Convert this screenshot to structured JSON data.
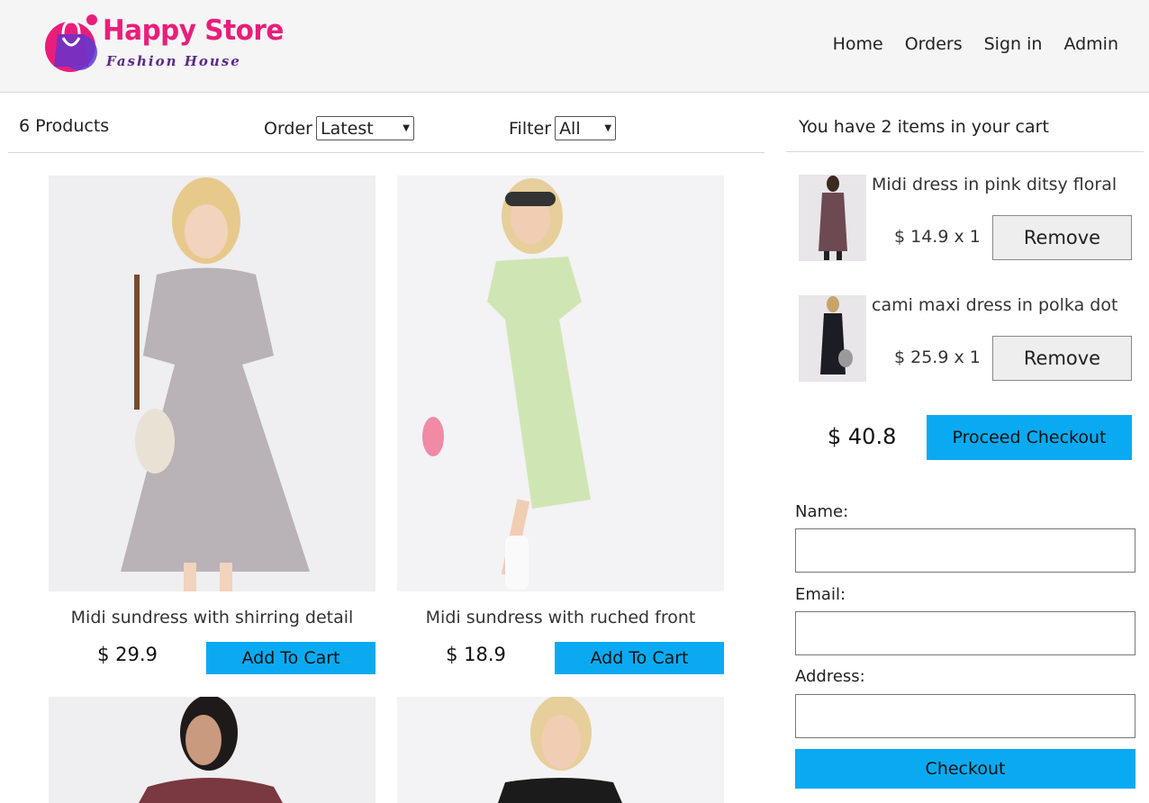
{
  "header": {
    "logo_title": "Happy Store",
    "logo_subtitle": "Fashion House",
    "nav": [
      "Home",
      "Orders",
      "Sign in",
      "Admin"
    ]
  },
  "toolbar": {
    "count": "6 Products",
    "order_label": "Order",
    "order_value": "Latest",
    "filter_label": "Filter",
    "filter_value": "All"
  },
  "products": [
    {
      "title": "Midi sundress with shirring detail",
      "price": "$ 29.9",
      "button": "Add To Cart",
      "color": "#b9b2b6"
    },
    {
      "title": "Midi sundress with ruched front",
      "price": "$ 18.9",
      "button": "Add To Cart",
      "color": "#cfe6b4"
    },
    {
      "title": "",
      "price": "",
      "button": "",
      "color": "#7a3840"
    },
    {
      "title": "",
      "price": "",
      "button": "",
      "color": "#1b1b1b"
    }
  ],
  "cart": {
    "heading": "You have 2 items in your cart",
    "items": [
      {
        "name": "Midi dress in pink ditsy floral",
        "qty": "$ 14.9 x 1",
        "button": "Remove"
      },
      {
        "name": "cami maxi dress in polka dot",
        "qty": "$ 25.9 x 1",
        "button": "Remove"
      }
    ],
    "total": "$ 40.8",
    "proceed": "Proceed Checkout",
    "form": {
      "name_label": "Name:",
      "email_label": "Email:",
      "address_label": "Address:",
      "name_value": "",
      "email_value": "",
      "address_value": "",
      "checkout": "Checkout"
    }
  },
  "colors": {
    "accent": "#0aaaf2",
    "logo_pink": "#e91e7a",
    "logo_purple": "#5b2a86"
  }
}
